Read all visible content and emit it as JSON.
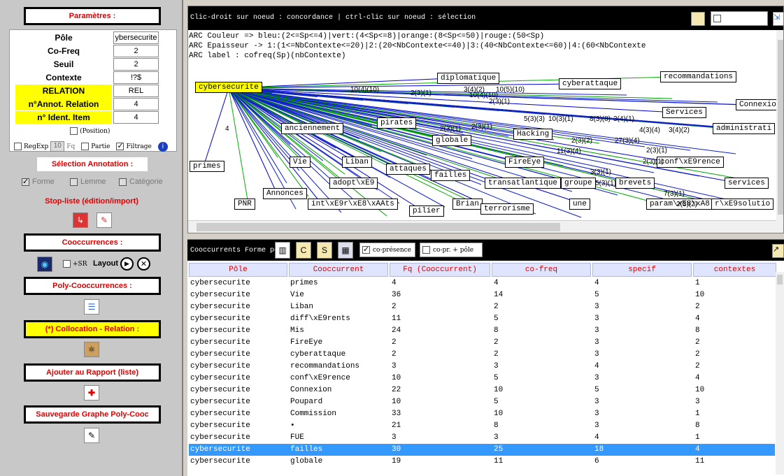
{
  "left": {
    "params_title": "Paramètres :",
    "params": [
      {
        "label": "Pôle",
        "value": "ybersecurite",
        "yellow": false
      },
      {
        "label": "Co-Freq",
        "value": "2",
        "yellow": false
      },
      {
        "label": "Seuil",
        "value": "2",
        "yellow": false
      },
      {
        "label": "Contexte",
        "value": "!?$",
        "yellow": false
      },
      {
        "label": "RELATION",
        "value": "REL",
        "yellow": true
      },
      {
        "label": "n°Annot. Relation",
        "value": "4",
        "yellow": true
      },
      {
        "label": "n° Ident. Item",
        "value": "4",
        "yellow": true
      }
    ],
    "position_label": "(Position)",
    "regexp_label": "RegExp",
    "fq_value": "10",
    "fq_label": "Fq",
    "partie_label": "Partie",
    "filtrage_label": "Filtrage",
    "selection_title": "Sélection Annotation :",
    "forme_label": "Forme",
    "lemme_label": "Lemme",
    "categorie_label": "Catégorie",
    "stopliste_label": "Stop-liste (édition/import)",
    "cooc_title": "Cooccurrences :",
    "sr_label": "+SR",
    "layout_label": "Layout",
    "poly_title": "Poly-Cooccurrences :",
    "colloc_title": "(*) Collocation - Relation :",
    "rapport_title": "Ajouter au Rapport (liste)",
    "sauvegarde_title": "Sauvegarde Graphe Poly-Cooc"
  },
  "graph": {
    "title": "Clic-droit sur noeud : concordance | ctrl-clic sur noeud : sélection",
    "copresence_label": "co-présence",
    "legend": [
      "ARC Couleur => bleu:(2<=Sp<=4)|vert:(4<Sp<=8)|orange:(8<Sp<=50)|rouge:(50<Sp)",
      "ARC Epaisseur -> 1:(1<=NbContexte<=20)|2:(20<NbContexte<=40)|3:(40<NbContexte<=60)|4:(60<NbContexte",
      "ARC label : cofreq(Sp)(nbContexte)"
    ],
    "nodes": [
      {
        "id": "cybersecurite",
        "label": "cybersecurite"
      },
      {
        "id": "diplomatique",
        "label": "diplomatique"
      },
      {
        "id": "cyberattaque",
        "label": "cyberattaque"
      },
      {
        "id": "recommandations",
        "label": "recommandations"
      },
      {
        "id": "Connexion",
        "label": "Connexio"
      },
      {
        "id": "Services",
        "label": "Services"
      },
      {
        "id": "administration",
        "label": "administrati"
      },
      {
        "id": "anciennement",
        "label": "anciennement"
      },
      {
        "id": "pirates",
        "label": "pirates"
      },
      {
        "id": "globale",
        "label": "globale"
      },
      {
        "id": "Hacking",
        "label": "Hacking"
      },
      {
        "id": "primes",
        "label": "primes"
      },
      {
        "id": "Vie",
        "label": "Vie"
      },
      {
        "id": "Liban",
        "label": "Liban"
      },
      {
        "id": "attaques",
        "label": "attaques"
      },
      {
        "id": "failles",
        "label": "failles"
      },
      {
        "id": "FireEye",
        "label": "FireEye"
      },
      {
        "id": "conference",
        "label": "conf\\xE9rence"
      },
      {
        "id": "adopte",
        "label": "adopt\\xE9"
      },
      {
        "id": "transatlantique",
        "label": "transatlantique"
      },
      {
        "id": "groupe",
        "label": "groupe"
      },
      {
        "id": "brevets",
        "label": "brevets"
      },
      {
        "id": "services",
        "label": "services"
      },
      {
        "id": "Annonces",
        "label": "Annonces"
      },
      {
        "id": "PNR",
        "label": "PNR"
      },
      {
        "id": "interets",
        "label": "int\\xE9r\\xE8\\xAAts"
      },
      {
        "id": "pilier",
        "label": "pilier"
      },
      {
        "id": "Brian",
        "label": "Brian"
      },
      {
        "id": "terrorisme",
        "label": "terrorisme"
      },
      {
        "id": "une",
        "label": "une"
      },
      {
        "id": "parametres",
        "label": "param\\xE8\\xA8"
      },
      {
        "id": "solution",
        "label": "r\\xE9solutio"
      }
    ],
    "edge_labels": [
      "10(4)(10)",
      "2(3)(1)",
      "3(4)(2)",
      "10(5)(10)",
      "10(4)(10)",
      "2(3)(1)",
      "4",
      "5(3)(3)",
      "10(3)(1)",
      "8(3)(8)",
      "3(4)(1)",
      "4(3)(4)",
      "3(4)(2)",
      "2(3)(1)",
      "2(3)(1)",
      "11(3)(4)",
      "2(3)(2)",
      "27(3)(4)",
      "2(3)(1)",
      "2(3)(1)",
      "3(3)(1)",
      "5(3)(1)",
      "7(3)(1)",
      "2(3)(2)"
    ]
  },
  "table": {
    "title": "Cooccurrents Forme pôle",
    "copresence_label": "co-présence",
    "copr_pole_label": "co-pr. + pôle",
    "columns": [
      "Pôle",
      "Cooccurrent",
      "Fq (Cooccurrent)",
      "co-freq",
      "specif",
      "contextes"
    ],
    "rows": [
      [
        "cybersecurite",
        "primes",
        "4",
        "4",
        "4",
        "1"
      ],
      [
        "cybersecurite",
        "Vie",
        "36",
        "14",
        "5",
        "10"
      ],
      [
        "cybersecurite",
        "Liban",
        "2",
        "2",
        "3",
        "2"
      ],
      [
        "cybersecurite",
        "diff\\xE9rents",
        "11",
        "5",
        "3",
        "4"
      ],
      [
        "cybersecurite",
        "Mis",
        "24",
        "8",
        "3",
        "8"
      ],
      [
        "cybersecurite",
        "FireEye",
        "2",
        "2",
        "3",
        "2"
      ],
      [
        "cybersecurite",
        "cyberattaque",
        "2",
        "2",
        "3",
        "2"
      ],
      [
        "cybersecurite",
        "recommandations",
        "3",
        "3",
        "4",
        "2"
      ],
      [
        "cybersecurite",
        "conf\\xE9rence",
        "10",
        "5",
        "3",
        "4"
      ],
      [
        "cybersecurite",
        "Connexion",
        "22",
        "10",
        "5",
        "10"
      ],
      [
        "cybersecurite",
        "Poupard",
        "10",
        "5",
        "3",
        "3"
      ],
      [
        "cybersecurite",
        "Commission",
        "33",
        "10",
        "3",
        "1"
      ],
      [
        "cybersecurite",
        "•",
        "21",
        "8",
        "3",
        "8"
      ],
      [
        "cybersecurite",
        "FUE",
        "3",
        "3",
        "4",
        "1"
      ],
      [
        "cybersecurite",
        "failles",
        "30",
        "25",
        "18",
        "4"
      ],
      [
        "cybersecurite",
        "globale",
        "19",
        "11",
        "6",
        "11"
      ]
    ],
    "selected_row": 14
  }
}
